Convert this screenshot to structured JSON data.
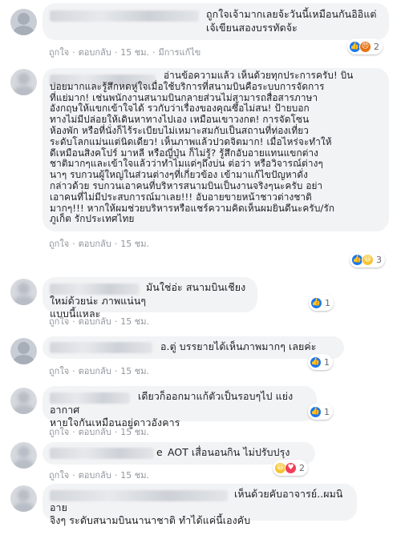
{
  "comments": [
    {
      "text": "ถูกใจเจ้ามากเลยจ้ะวันนี้เหมือนกันอิอิแต่\nเจ้เขียนสองบรรทัดจ้ะ",
      "actions": {
        "like": "ถูกใจ",
        "reply": "ตอบกลับ",
        "time": "15 ชม.",
        "edited": "มีการแก้ไข"
      },
      "reactions": {
        "icons": [
          "like",
          "angry"
        ],
        "count": "2"
      }
    },
    {
      "text": "อ่านข้อความแล้ว เห็นด้วยทุกประการครับ! บิน\nบ่อยมากและรู้สึกหดหู่ใจเมื่อใช้บริการที่สนามบินคือระบบการจัดการ\nที่แย่มาก! เช่นพนักงานสนามบินกลายส่วนไม่สามารถสื่อสารภาษา\nอังกฤษให้แขกเข้าใจได้ รวกับว่าเรื่องของคุณซึ้อไม่สน! ป้ายบอก\nทางไม่มีปล่อยให้เดินหาทางไปเอง เหมือนเขาวงกต! การจัดโซน\nห้องพัก หรือที่นั่งก็ไร้ระเบียบไม่เหมาะสมกับเป็นสถานที่ท่องเที่ยว\nระดับโลกแม่นแต่นิดเดียว! เห็นภาพแล้วปวดจิตมาก! เมื่อไหร่จะทำให้\nดีเหมือนสิงคโปร์ มาหลี หรือญี่ปุ่น ก็ไม่รู้? รู้สึกอับอายแทนแขกต่าง\nชาติมากๆและเข้าใจแล้วว่าทำไมแด่ๆถึงบ่น ต่อว่า หรือวิจารณ์ต่างๆ\nนาๆ รบกวนผู้ใหญ่ในส่วนต่างๆที่เกี่ยวข้อง เข้ามาแก้ไขปัญหาดั่ง\nกล่าวด้วย รบกวนเอาคนที่บริหารสนามบินเป็นงานจริงๆนะครับ อย่า\nเอาคนที่ไม่มีประสบการณ์มาเลย!!! อับอายขายหน้าชาวต่างชาติ\nมากๆ!!! หากให้ผมช่วยบริหารหรือแชร์ความคิดเห็นผมยินดีนะครับ/รัก\nภูเก็ต รักประเทศไทย",
      "actions": {
        "like": "ถูกใจ",
        "reply": "ตอบกลับ",
        "time": "15 ชม."
      },
      "reactions": {
        "icons": [
          "like",
          "haha"
        ],
        "count": "3"
      }
    },
    {
      "text": "มันใช่อ่ะ สนามบินเชียงใหม่ด้วยน่ะ ภาพแน่นๆ\nแบบนี้แหละ",
      "actions": {
        "like": "ถูกใจ",
        "reply": "ตอบกลับ",
        "time": "15 ชม."
      },
      "reactions": {
        "icons": [
          "like"
        ],
        "count": "1"
      }
    },
    {
      "text": "อ.ตู่ บรรยายได้เห็นภาพมากๆ เลยค่ะ",
      "actions": {
        "like": "ถูกใจ",
        "reply": "ตอบกลับ",
        "time": "15 ชม."
      },
      "reactions": {
        "icons": [
          "like"
        ],
        "count": "1"
      }
    },
    {
      "text": "เดียวก็ออกมาแก้ตัวเป็นรอบๆไป แย่งอากาศ\nหายใจกันเหมือนอยู่ดาวอังคาร",
      "actions": {
        "like": "ถูกใจ",
        "reply": "ตอบกลับ",
        "time": "15 ชม."
      },
      "reactions": {
        "icons": [
          "like"
        ],
        "count": "1"
      }
    },
    {
      "name_tail": "e",
      "text": "AOT เสื่อนอนกิน ไม่ปรับปรุง",
      "actions": {
        "like": "ถูกใจ",
        "reply": "ตอบกลับ",
        "time": "15 ชม."
      },
      "reactions": {
        "icons": [
          "haha",
          "love"
        ],
        "count": "2"
      }
    },
    {
      "text": "เห็นด้วยคับอาจารย์..ผมนิอาย\nจิงๆ ระดับสนามบินนานาชาติ ทำได้แค่นี้เองคับ"
    }
  ],
  "colors": {
    "bubble": "#f2f3f5",
    "text": "#1c1e21",
    "meta": "#90949c",
    "like": "#1877f2"
  }
}
